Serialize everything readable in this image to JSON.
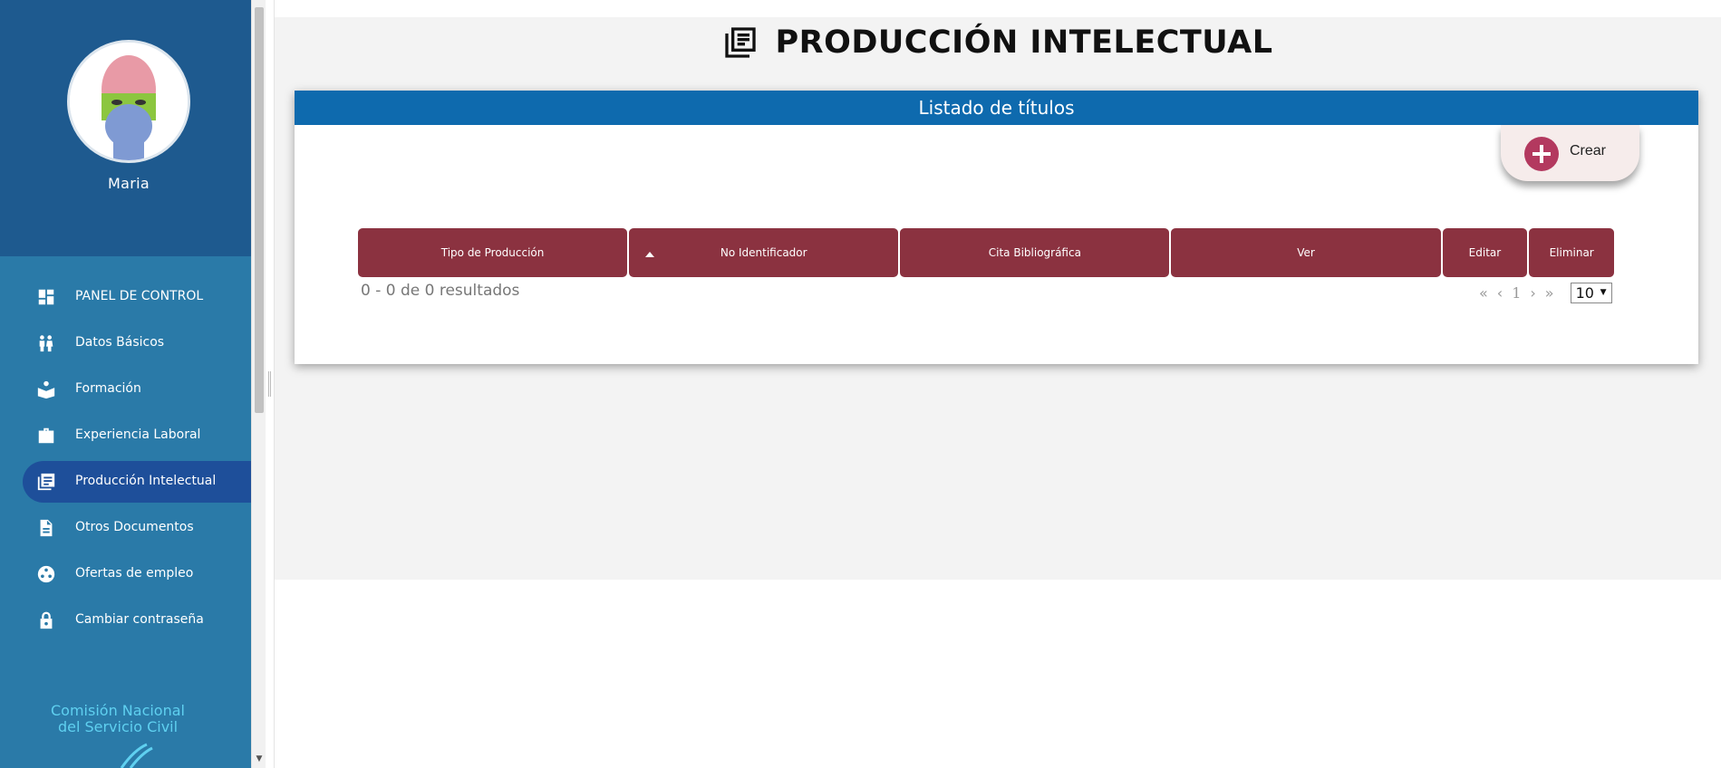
{
  "user": {
    "name": "Maria"
  },
  "sidebar": {
    "items": [
      {
        "label": "PANEL DE CONTROL",
        "icon": "dashboard-icon"
      },
      {
        "label": "Datos Básicos",
        "icon": "people-icon"
      },
      {
        "label": "Formación",
        "icon": "reading-book-icon"
      },
      {
        "label": "Experiencia Laboral",
        "icon": "briefcase-icon"
      },
      {
        "label": "Producción Intelectual",
        "icon": "library-books-icon",
        "active": true
      },
      {
        "label": "Otros Documentos",
        "icon": "document-icon"
      },
      {
        "label": "Ofertas de empleo",
        "icon": "network-icon"
      },
      {
        "label": "Cambiar contraseña",
        "icon": "lock-icon"
      }
    ],
    "logo_line1": "Comisión Nacional",
    "logo_line2": "del Servicio Civil"
  },
  "page": {
    "title": "PRODUCCIÓN INTELECTUAL",
    "title_icon": "library-books-icon"
  },
  "card": {
    "header": "Listado de títulos",
    "create_label": "Crear"
  },
  "table": {
    "columns": [
      "Tipo de Producción",
      "No Identificador",
      "Cita Bibliográfica",
      "Ver",
      "Editar",
      "Eliminar"
    ]
  },
  "pagination": {
    "results_text": "0 - 0 de 0 resultados",
    "first": "«",
    "prev": "‹",
    "current_page": "1",
    "next": "›",
    "last": "»",
    "page_size": "10"
  },
  "colors": {
    "sidebar_top": "#1e5a8f",
    "sidebar": "#2a7aa8",
    "active_item": "#1e4f9a",
    "card_header": "#0e6aae",
    "table_header": "#8b3240",
    "create_icon": "#b3395f"
  }
}
